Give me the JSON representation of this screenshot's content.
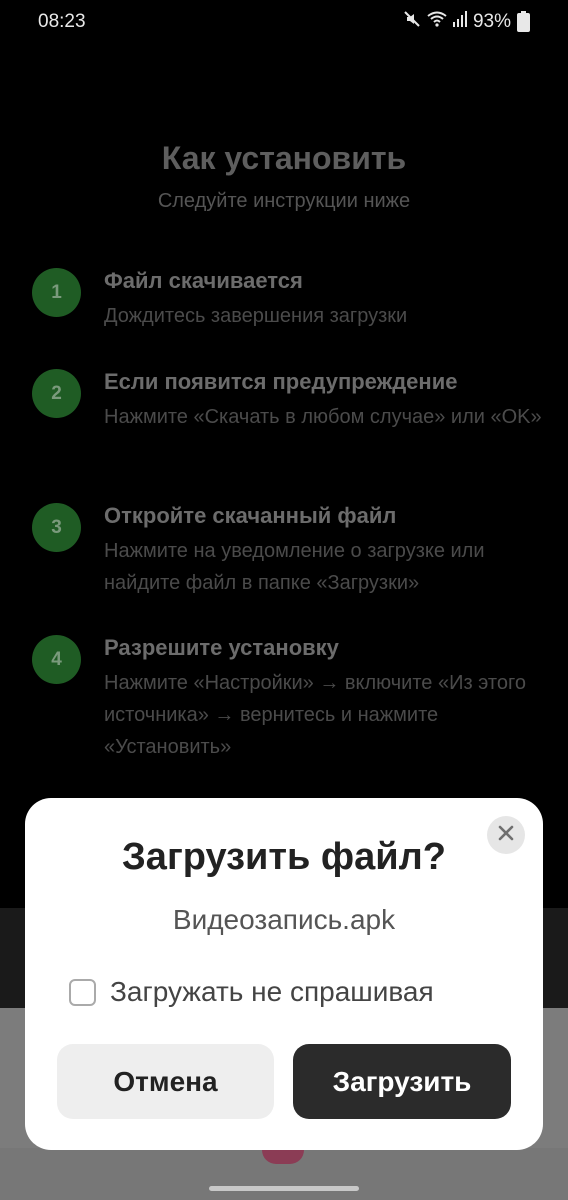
{
  "status_bar": {
    "time": "08:23",
    "battery": "93%",
    "icons": [
      "mute-icon",
      "wifi-icon",
      "signal-icon",
      "battery-icon"
    ]
  },
  "page": {
    "title": "Как установить",
    "subtitle": "Следуйте инструкции ниже",
    "steps": [
      {
        "number": "1",
        "title": "Файл скачивается",
        "description": "Дождитесь завершения загрузки"
      },
      {
        "number": "2",
        "title": "Если появится предупреждение",
        "description": "Нажмите «Скачать в любом случае» или «OK»"
      },
      {
        "number": "3",
        "title": "Откройте скачанный файл",
        "description": "Нажмите на уведомление о загрузке или найдите файл в папке «Загрузки»"
      },
      {
        "number": "4",
        "title": "Разрешите установку",
        "description": "Нажмите «Настройки» → включите «Из этого источника» → вернитесь и нажмите «Установить»"
      }
    ]
  },
  "dialog": {
    "title": "Загрузить файл?",
    "filename": "Видеозапись.apk",
    "checkbox_label": "Загружать не спрашивая",
    "checkbox_checked": false,
    "cancel_label": "Отмена",
    "confirm_label": "Загрузить",
    "close_icon": "close-icon"
  },
  "colors": {
    "step_badge": "#1f5c24",
    "dialog_bg": "#ffffff",
    "primary_button": "#2b2b2b",
    "secondary_button": "#eeeeee"
  }
}
